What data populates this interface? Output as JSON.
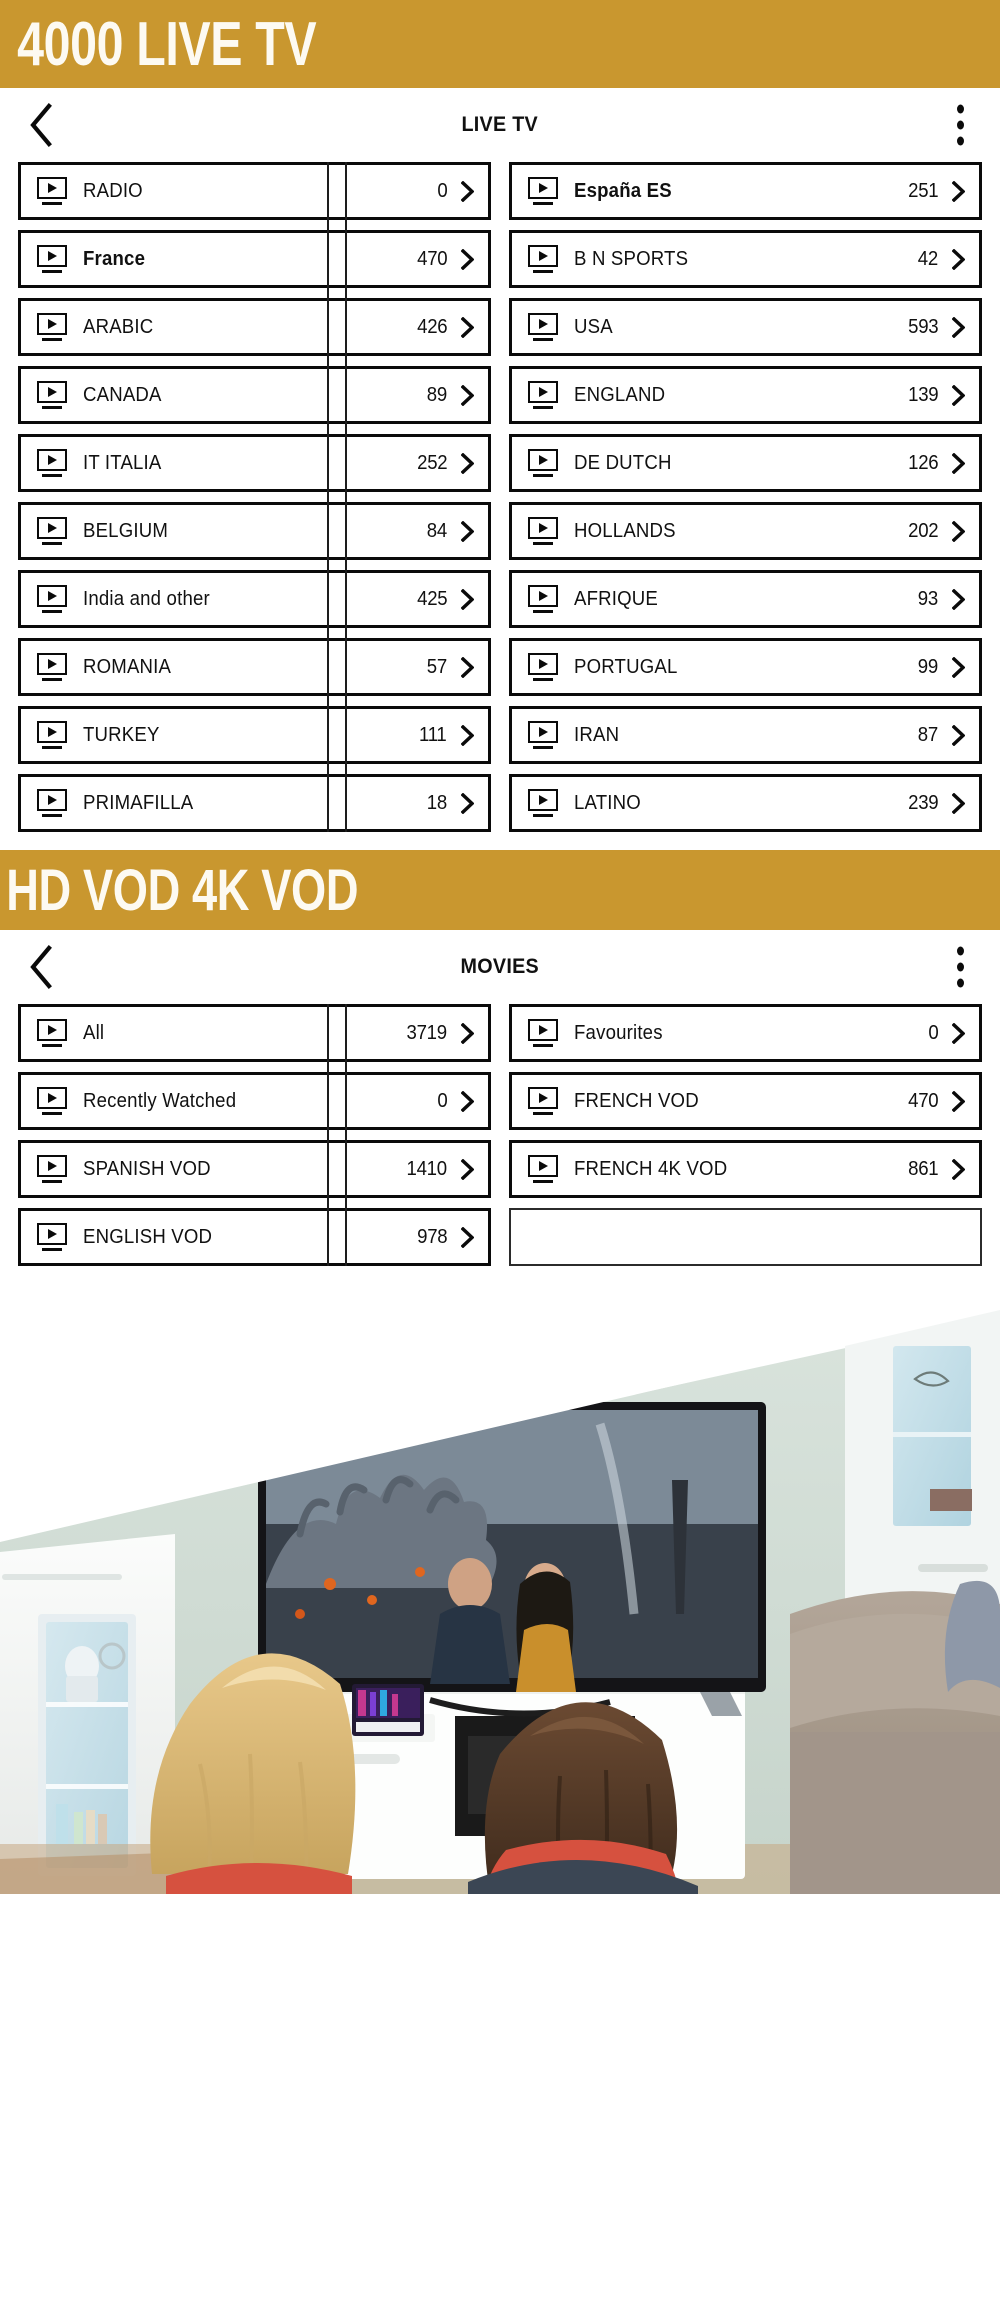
{
  "banners": {
    "live": "4000 LIVE TV",
    "vod": "HD VOD  4K VOD"
  },
  "live_tv_screen": {
    "title": "LIVE TV",
    "back_icon": "chevron-left-icon",
    "menu_icon": "more-vertical-icon",
    "rows": [
      [
        {
          "label": "RADIO",
          "count": "0",
          "bold": false
        },
        {
          "label": "España  ES",
          "count": "251",
          "bold": true
        }
      ],
      [
        {
          "label": "France",
          "count": "470",
          "bold": true
        },
        {
          "label": "B  N SPORTS",
          "count": "42",
          "bold": false
        }
      ],
      [
        {
          "label": "ARABIC",
          "count": "426",
          "bold": false
        },
        {
          "label": "USA",
          "count": "593",
          "bold": false
        }
      ],
      [
        {
          "label": "CANADA",
          "count": "89",
          "bold": false
        },
        {
          "label": "ENGLAND",
          "count": "139",
          "bold": false
        }
      ],
      [
        {
          "label": "IT   ITALIA",
          "count": "252",
          "bold": false
        },
        {
          "label": "DE  DUTCH",
          "count": "126",
          "bold": false
        }
      ],
      [
        {
          "label": "BELGIUM",
          "count": "84",
          "bold": false
        },
        {
          "label": "HOLLANDS",
          "count": "202",
          "bold": false
        }
      ],
      [
        {
          "label": "India and other",
          "count": "425",
          "bold": false
        },
        {
          "label": "AFRIQUE",
          "count": "93",
          "bold": false
        }
      ],
      [
        {
          "label": "ROMANIA",
          "count": "57",
          "bold": false
        },
        {
          "label": "PORTUGAL",
          "count": "99",
          "bold": false
        }
      ],
      [
        {
          "label": "TURKEY",
          "count": "111",
          "bold": false
        },
        {
          "label": "IRAN",
          "count": "87",
          "bold": false
        }
      ],
      [
        {
          "label": "PRIMAFILLA",
          "count": "18",
          "bold": false
        },
        {
          "label": "LATINO",
          "count": "239",
          "bold": false
        }
      ]
    ]
  },
  "movies_screen": {
    "title": "MOVIES",
    "back_icon": "chevron-left-icon",
    "menu_icon": "more-vertical-icon",
    "rows": [
      [
        {
          "label": "All",
          "count": "3719",
          "bold": false
        },
        {
          "label": "Favourites",
          "count": "0",
          "bold": false
        }
      ],
      [
        {
          "label": "Recently Watched",
          "count": "0",
          "bold": false
        },
        {
          "label": "FRENCH VOD",
          "count": "470",
          "bold": false
        }
      ],
      [
        {
          "label": "SPANISH VOD",
          "count": "1410",
          "bold": false
        },
        {
          "label": "FRENCH 4K VOD",
          "count": "861",
          "bold": false
        }
      ],
      [
        {
          "label": "ENGLISH VOD",
          "count": "978",
          "bold": false
        },
        {
          "label": "",
          "count": "",
          "bold": false,
          "empty": true
        }
      ]
    ]
  },
  "photo": {
    "alt": "two people watching a large TV in a living room",
    "colors": {
      "wall": "#cfdcd4",
      "tv_bezel": "#1b1b1e",
      "sofa": "#a79a8e",
      "cabinet": "#f4f5f3",
      "floor": "#c7a882"
    }
  },
  "theme": {
    "banner_gold": "#c9972f",
    "banner_text": "#fdfaf2",
    "ink": "#0a0a0a",
    "page_bg": "#ffffff"
  },
  "icons": {
    "row_icon": "tv-monitor-play-icon",
    "row_chevron": "chevron-right-icon"
  }
}
